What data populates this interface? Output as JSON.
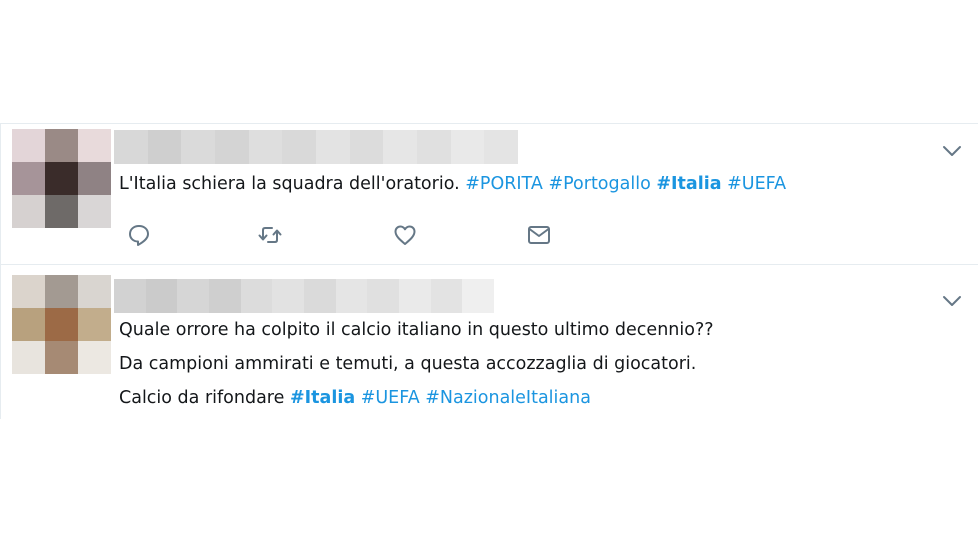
{
  "tweets": [
    {
      "text": "L'Italia schiera la squadra dell'oratorio.",
      "hashtags": [
        "#PORITA",
        "#Portogallo",
        "#Italia",
        "#UEFA"
      ],
      "avatar_colors": [
        "#e3d5d8",
        "#9a8a86",
        "#e8dadb",
        "#a69499",
        "#3a2c2a",
        "#8f8284",
        "#d6d1d0",
        "#6e6a68",
        "#d9d6d6"
      ],
      "actions": [
        "reply-icon",
        "retweet-icon",
        "like-icon",
        "message-icon"
      ]
    },
    {
      "lines": [
        "Quale orrore ha colpito il calcio italiano in questo ultimo decennio??",
        "Da campioni ammirati e temuti, a questa accozzaglia di giocatori.",
        "Calcio da rifondare"
      ],
      "hashtags": [
        "#Italia",
        "#UEFA",
        "#NazionaleItaliana"
      ],
      "avatar_colors": [
        "#dbd4cc",
        "#a39a92",
        "#d9d5d0",
        "#b8a17e",
        "#9c6a46",
        "#c2ad8c",
        "#e8e4de",
        "#a68a74",
        "#ece8e2"
      ]
    }
  ],
  "colors": {
    "hashtag": "#1b95e0",
    "icon": "#657786",
    "divider": "#e6ecf0",
    "text": "#14171a"
  }
}
